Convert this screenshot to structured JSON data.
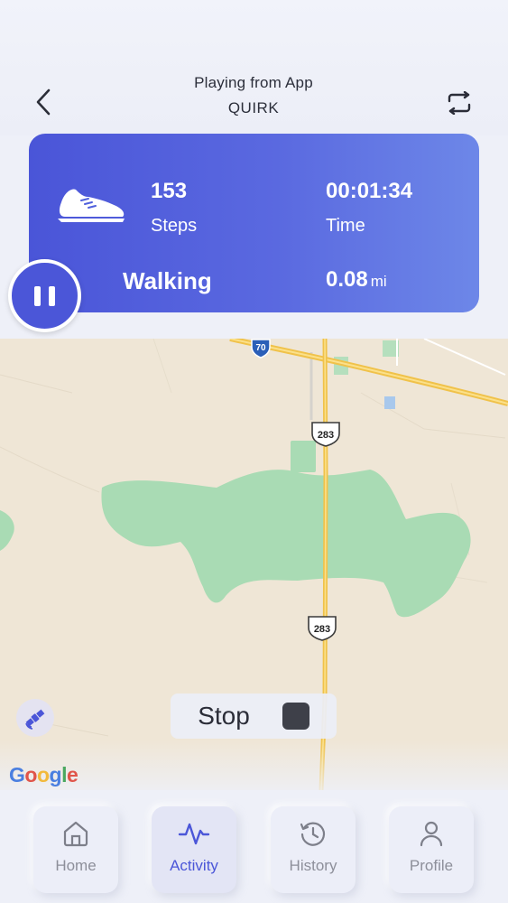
{
  "header": {
    "subtitle": "Playing from App",
    "title": "QUIRK",
    "back_icon": "chevron-left-icon",
    "switch_icon": "repeat-icon"
  },
  "stats": {
    "steps_value": "153",
    "steps_label": "Steps",
    "time_value": "00:01:34",
    "time_label": "Time",
    "activity": "Walking",
    "distance_value": "0.08",
    "distance_unit": "mi",
    "card_icon": "shoe-icon"
  },
  "map": {
    "shields": {
      "interstate": "70",
      "us_north": "283",
      "us_south": "283"
    },
    "attribution": [
      "G",
      "o",
      "o",
      "g",
      "l",
      "e"
    ]
  },
  "controls": {
    "pause_icon": "pause-icon",
    "stop_label": "Stop",
    "stop_icon": "stop-square-icon",
    "satellite_icon": "satellite-icon"
  },
  "nav": {
    "items": [
      {
        "label": "Home",
        "icon": "home-icon",
        "active": false
      },
      {
        "label": "Activity",
        "icon": "activity-pulse-icon",
        "active": true
      },
      {
        "label": "History",
        "icon": "history-clock-icon",
        "active": false
      },
      {
        "label": "Profile",
        "icon": "user-icon",
        "active": false
      }
    ]
  },
  "colors": {
    "accent": "#4b56d8",
    "map_land": "#efe6d6",
    "map_park": "#a9dbb4",
    "map_road": "#f5c84a"
  }
}
